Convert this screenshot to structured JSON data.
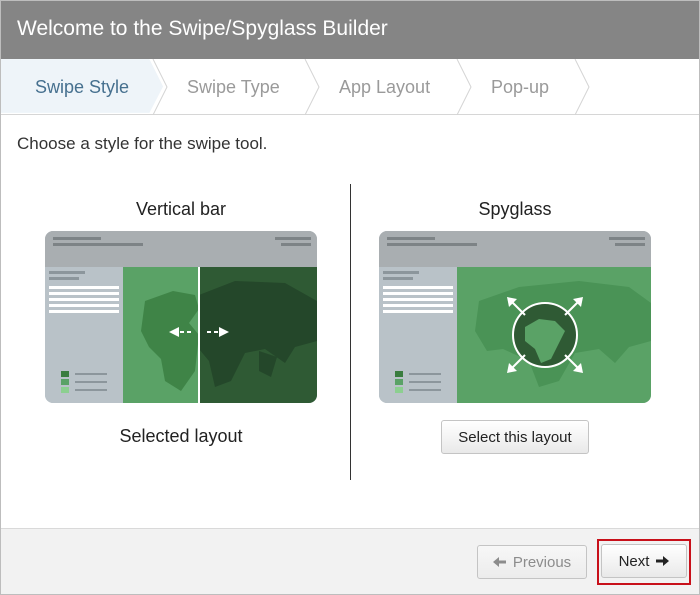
{
  "window": {
    "title": "Welcome to the Swipe/Spyglass Builder"
  },
  "steps": [
    {
      "label": "Swipe Style",
      "active": true
    },
    {
      "label": "Swipe Type",
      "active": false
    },
    {
      "label": "App Layout",
      "active": false
    },
    {
      "label": "Pop-up",
      "active": false
    }
  ],
  "content": {
    "instructions": "Choose a style for the swipe tool.",
    "options": [
      {
        "title": "Vertical bar",
        "status": "Selected layout"
      },
      {
        "title": "Spyglass",
        "button": "Select this layout"
      }
    ]
  },
  "footer": {
    "previous_label": "Previous",
    "next_label": "Next",
    "previous_enabled": false
  },
  "colors": {
    "title_bar": "#858585",
    "active_step_text": "#46708f",
    "map_green": "#5aa266",
    "map_dark_green": "#2f5a34",
    "highlight_border": "#c8101a"
  },
  "icons": {
    "previous": "arrow-left-icon",
    "next": "arrow-right-icon",
    "step_separator": "chevron-right-icon"
  }
}
